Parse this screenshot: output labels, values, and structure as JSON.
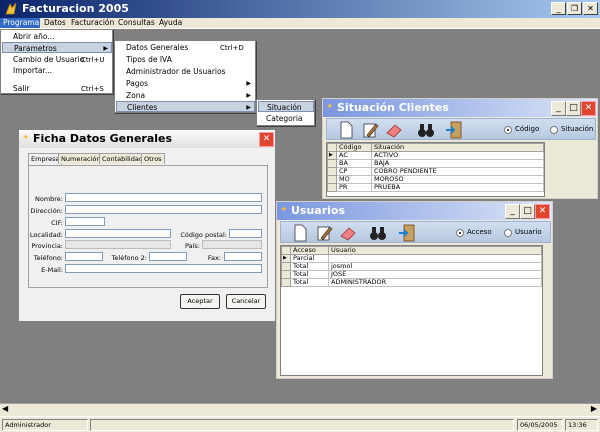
{
  "app": {
    "title": "Facturacion 2005"
  },
  "menubar": [
    "Programa",
    "Datos",
    "Facturación",
    "Consultas",
    "Ayuda"
  ],
  "programa_menu": [
    {
      "label": "Abrir año...",
      "shortcut": ""
    },
    {
      "label": "Parametros",
      "shortcut": ""
    },
    {
      "label": "Cambio de Usuario",
      "shortcut": "Ctrl+U"
    },
    {
      "label": "Importar...",
      "shortcut": ""
    },
    {
      "label": "Salir",
      "shortcut": "Ctrl+S"
    }
  ],
  "parametros_menu": [
    {
      "label": "Datos Generales",
      "shortcut": "Ctrl+D"
    },
    {
      "label": "Tipos de IVA",
      "shortcut": ""
    },
    {
      "label": "Administrador de Usuarios",
      "shortcut": ""
    },
    {
      "label": "Pagos",
      "shortcut": ""
    },
    {
      "label": "Zona",
      "shortcut": ""
    },
    {
      "label": "Clientes",
      "shortcut": ""
    }
  ],
  "clientes_menu": [
    "Situación",
    "Categoria"
  ],
  "situacion": {
    "title": "Situación Clientes",
    "radio_codigo": "Código",
    "radio_situacion": "Situación",
    "columns": [
      "Código",
      "Situación"
    ],
    "rows": [
      [
        "AC",
        "ACTIVO"
      ],
      [
        "BA",
        "BAJA"
      ],
      [
        "CP",
        "COBRO PENDIENTE"
      ],
      [
        "MO",
        "MOROSO"
      ],
      [
        "PR",
        "PRUEBA"
      ]
    ]
  },
  "usuarios": {
    "title": "Usuarios",
    "radio_acceso": "Acceso",
    "radio_usuario": "Usuario",
    "columns": [
      "Acceso",
      "Usuario"
    ],
    "rows": [
      [
        "Parcial",
        ""
      ],
      [
        "Total",
        "josmol"
      ],
      [
        "Total",
        "JOSE"
      ],
      [
        "Total",
        "ADMINISTRADOR"
      ]
    ]
  },
  "ficha": {
    "title": "Ficha Datos Generales",
    "tabs": [
      "Empresa",
      "Numeración",
      "Contabilidad",
      "Otros"
    ],
    "labels": {
      "nombre": "Nombre:",
      "direccion": "Dirección:",
      "cif": "CIF:",
      "localidad": "Localidad:",
      "codigo_postal": "Código postal:",
      "provincia": "Provincia:",
      "pais": "País:",
      "telefono": "Teléfono:",
      "telefono2": "Teléfono 2:",
      "fax": "Fax:",
      "email": "E-Mail:"
    },
    "accept": "Aceptar",
    "cancel": "Cancelar"
  },
  "status": {
    "user": "Administrador",
    "date": "06/05/2005",
    "time": "13:36"
  },
  "colors": {
    "title_start": "#0a246a",
    "child_caption": "#7a96df",
    "close_red": "#e0452e"
  }
}
